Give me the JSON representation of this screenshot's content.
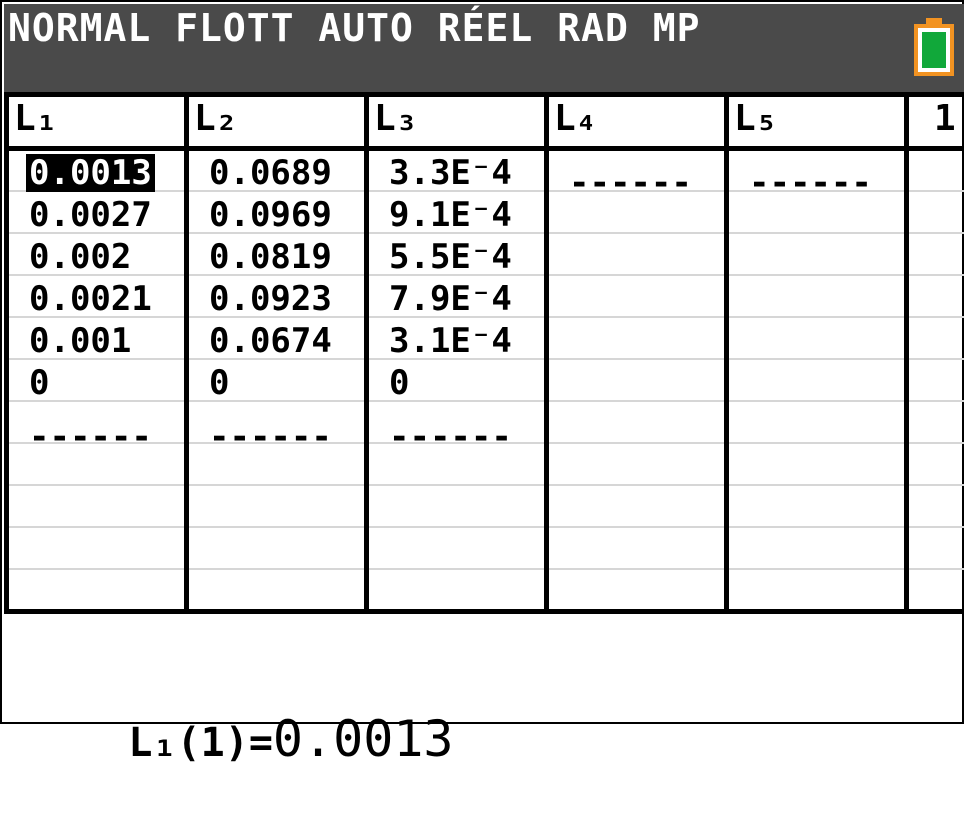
{
  "status_bar": {
    "mode_text": "NORMAL FLOTT AUTO RÉEL RAD MP",
    "battery_color": "#f29322",
    "battery_fill_color": "#11a83a"
  },
  "table": {
    "headers": [
      "L₁",
      "L₂",
      "L₃",
      "L₄",
      "L₅",
      "1"
    ],
    "columns": [
      [
        "0.0013",
        "0.0027",
        "0.002",
        "0.0021",
        "0.001",
        "0",
        "------"
      ],
      [
        "0.0689",
        "0.0969",
        "0.0819",
        "0.0923",
        "0.0674",
        "0",
        "------"
      ],
      [
        "3.3E⁻4",
        "9.1E⁻4",
        "5.5E⁻4",
        "7.9E⁻4",
        "3.1E⁻4",
        "0",
        "------"
      ],
      [
        "------"
      ],
      [
        "------"
      ]
    ],
    "selected": {
      "column": 0,
      "row": 0
    }
  },
  "entry_line": {
    "prefix": "L₁(1)=",
    "value": "0.0013"
  }
}
